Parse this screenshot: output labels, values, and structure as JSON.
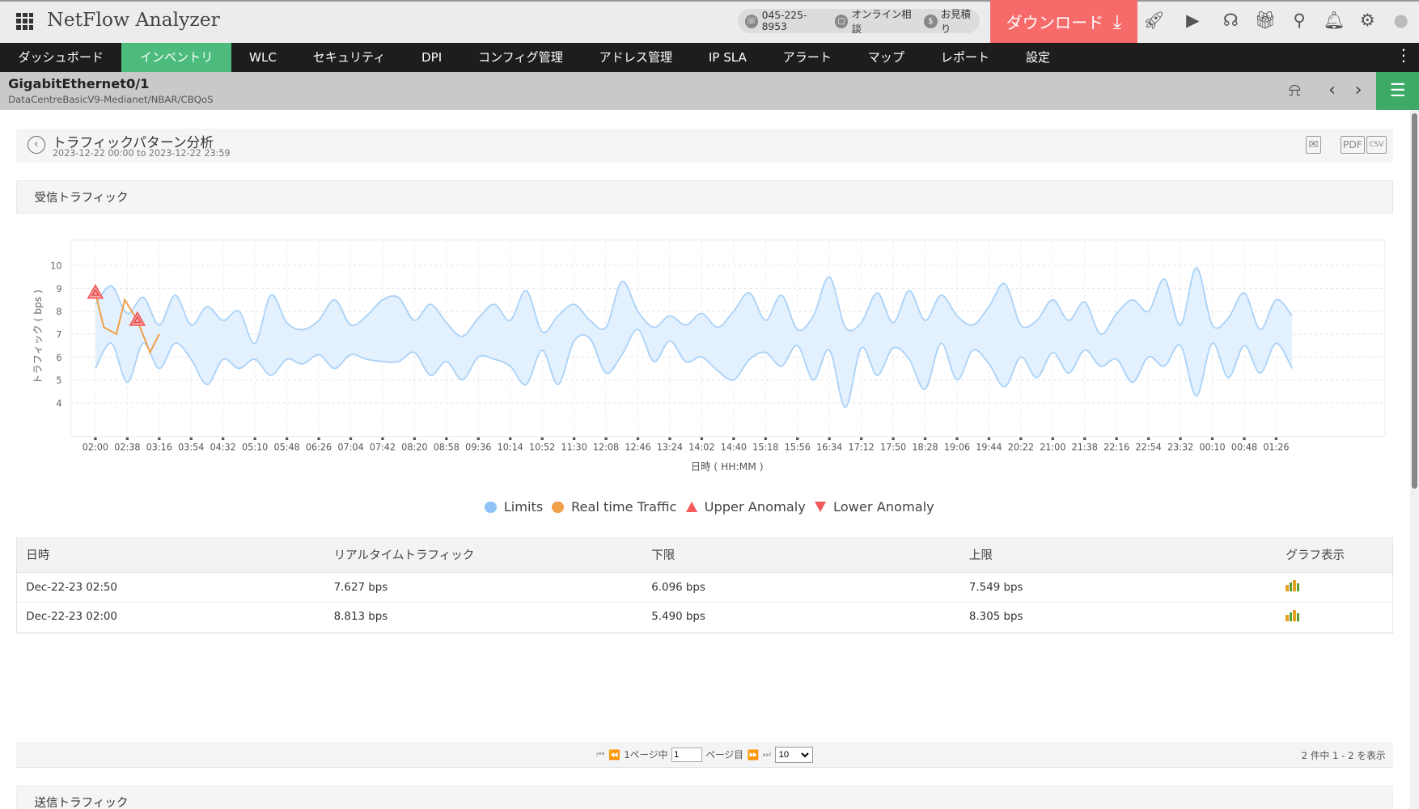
{
  "header": {
    "app_title": "NetFlow Analyzer",
    "phone": "045-225-8953",
    "online": "オンライン相談",
    "quote": "お見積り",
    "download": "ダウンロード"
  },
  "nav": {
    "items": [
      "ダッシュボード",
      "インベントリ",
      "WLC",
      "セキュリティ",
      "DPI",
      "コンフィグ管理",
      "アドレス管理",
      "IP SLA",
      "アラート",
      "マップ",
      "レポート",
      "設定"
    ],
    "active": 1
  },
  "device": {
    "name": "GigabitEthernet0/1",
    "path": "DataCentreBasicV9-Medianet/NBAR/CBQoS"
  },
  "panel": {
    "title": "トラフィックパターン分析",
    "range": "2023-12-22 00:00 to 2023-12-22 23:59",
    "section_in": "受信トラフィック",
    "section_out": "送信トラフィック"
  },
  "chart_data": {
    "type": "area",
    "xlabel": "日時 ( HH:MM )",
    "ylabel": "トラフィック ( bps )",
    "yticks": [
      4,
      5,
      6,
      7,
      8,
      9,
      10
    ],
    "xticks": [
      "02:00",
      "02:38",
      "03:16",
      "03:54",
      "04:32",
      "05:10",
      "05:48",
      "06:26",
      "07:04",
      "07:42",
      "08:20",
      "08:58",
      "09:36",
      "10:14",
      "10:52",
      "11:30",
      "12:08",
      "12:46",
      "13:24",
      "14:02",
      "14:40",
      "15:18",
      "15:56",
      "16:34",
      "17:12",
      "17:50",
      "18:28",
      "19:06",
      "19:44",
      "20:22",
      "21:00",
      "21:38",
      "22:16",
      "22:54",
      "23:32",
      "00:10",
      "00:48",
      "01:26"
    ],
    "xtick_step_minutes": 38,
    "limits_step_minutes": 19,
    "upper_limit": [
      8.3,
      9.1,
      7.9,
      8.6,
      7.4,
      8.7,
      7.4,
      8.2,
      7.6,
      8.0,
      6.6,
      8.7,
      7.5,
      7.2,
      7.6,
      8.5,
      7.4,
      7.8,
      8.5,
      8.6,
      7.6,
      8.3,
      7.5,
      6.9,
      7.7,
      8.3,
      7.6,
      8.9,
      7.1,
      7.8,
      8.3,
      7.6,
      7.3,
      9.3,
      8.0,
      7.3,
      7.8,
      7.4,
      7.9,
      7.3,
      8.0,
      8.8,
      7.6,
      8.7,
      7.2,
      7.8,
      9.5,
      7.3,
      7.5,
      8.8,
      7.5,
      8.9,
      7.6,
      8.7,
      7.8,
      7.4,
      8.2,
      9.2,
      7.4,
      7.6,
      8.5,
      7.6,
      8.4,
      7.0,
      7.9,
      8.5,
      8.0,
      9.4,
      7.4,
      9.9,
      7.4,
      7.7,
      8.8,
      7.2,
      8.5,
      7.8
    ],
    "lower_limit": [
      5.5,
      6.6,
      4.9,
      6.6,
      5.5,
      6.6,
      5.9,
      4.8,
      5.9,
      5.5,
      5.9,
      5.2,
      5.9,
      5.7,
      6.1,
      5.5,
      6.1,
      5.9,
      5.8,
      5.8,
      6.2,
      5.2,
      5.8,
      5.0,
      6.0,
      5.9,
      5.6,
      4.8,
      6.3,
      4.8,
      6.7,
      6.8,
      5.3,
      6.1,
      7.2,
      5.8,
      6.7,
      5.8,
      6.0,
      5.4,
      5.0,
      5.9,
      6.2,
      5.6,
      6.5,
      5.0,
      6.3,
      3.8,
      6.4,
      5.2,
      6.4,
      5.9,
      4.6,
      6.6,
      5.0,
      6.3,
      5.7,
      4.7,
      6.0,
      5.1,
      6.2,
      5.3,
      6.3,
      5.6,
      5.9,
      4.9,
      6.0,
      5.6,
      6.5,
      4.3,
      6.6,
      5.1,
      6.5,
      5.3,
      6.6,
      5.5
    ],
    "realtime": {
      "minutes": [
        0,
        10,
        25,
        35,
        50,
        65,
        76
      ],
      "values": [
        8.8,
        7.3,
        7.0,
        8.5,
        7.6,
        6.2,
        7.0
      ]
    },
    "upper_anomalies": {
      "minutes": [
        0,
        50
      ],
      "values": [
        8.813,
        7.627
      ]
    },
    "lower_anomalies": {
      "minutes": [],
      "values": []
    },
    "legend": [
      "Limits",
      "Real time Traffic",
      "Upper Anomaly",
      "Lower Anomaly"
    ],
    "colors": {
      "limits": "#9ecbf5",
      "band": "#e3f0fd",
      "realtime": "#f0a04b",
      "upper": "#f25a5a",
      "lower": "#f25a5a"
    }
  },
  "table": {
    "headers": [
      "日時",
      "リアルタイムトラフィック",
      "下限",
      "上限",
      "グラフ表示"
    ],
    "rows": [
      [
        "Dec-22-23 02:50",
        "7.627 bps",
        "6.096 bps",
        "7.549 bps"
      ],
      [
        "Dec-22-23 02:00",
        "8.813 bps",
        "5.490 bps",
        "8.305 bps"
      ]
    ]
  },
  "pager": {
    "page_of": "1ページ中",
    "page": "1",
    "page_suffix": "ページ目",
    "per_page": "10",
    "summary": "2 件中 1 - 2 を表示"
  }
}
